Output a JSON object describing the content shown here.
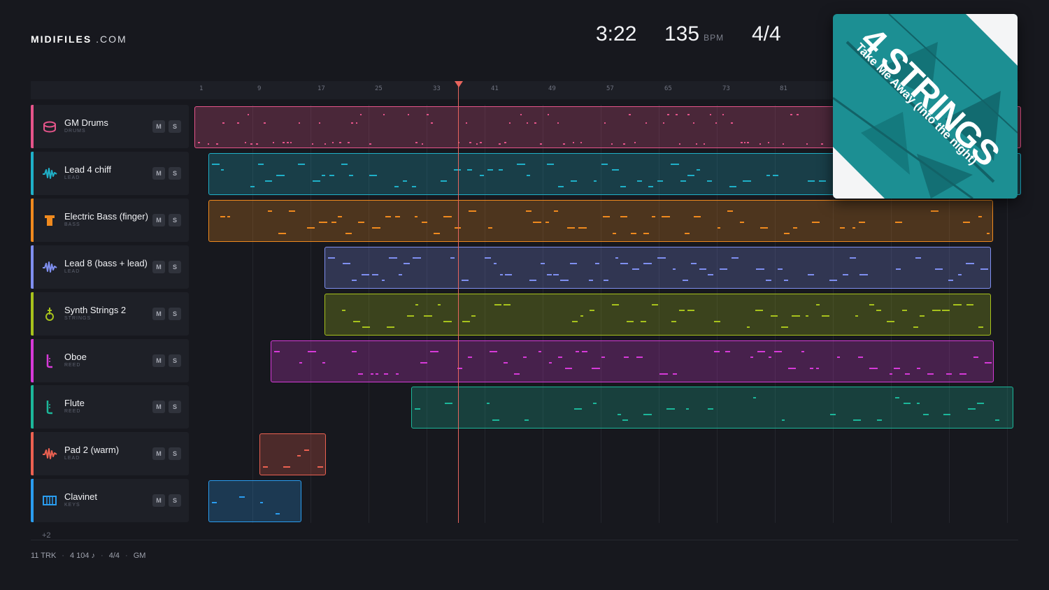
{
  "brand": {
    "bold": "MIDIFILES",
    "light": ".COM"
  },
  "transport": {
    "time": "3:22",
    "bpm": "135",
    "bpm_unit": "BPM",
    "signature": "4/4"
  },
  "ruler_ticks": [
    "1",
    "9",
    "17",
    "25",
    "33",
    "41",
    "49",
    "57",
    "65",
    "73",
    "81"
  ],
  "tracks": [
    {
      "name": "GM Drums",
      "category": "DRUMS",
      "color": "#e5548a",
      "icon": "drum-icon",
      "mute": "M",
      "solo": "S"
    },
    {
      "name": "Lead 4 chiff",
      "category": "LEAD",
      "color": "#1fb0c8",
      "icon": "waveform-icon",
      "mute": "M",
      "solo": "S"
    },
    {
      "name": "Electric Bass (finger)",
      "category": "BASS",
      "color": "#f08a1e",
      "icon": "bass-icon",
      "mute": "M",
      "solo": "S"
    },
    {
      "name": "Lead 8 (bass + lead)",
      "category": "LEAD",
      "color": "#7f8ff0",
      "icon": "waveform-icon",
      "mute": "M",
      "solo": "S"
    },
    {
      "name": "Synth Strings 2",
      "category": "STRINGS",
      "color": "#a7c21c",
      "icon": "strings-icon",
      "mute": "M",
      "solo": "S"
    },
    {
      "name": "Oboe",
      "category": "REED",
      "color": "#d63ad8",
      "icon": "reed-icon",
      "mute": "M",
      "solo": "S"
    },
    {
      "name": "Flute",
      "category": "REED",
      "color": "#1cb79a",
      "icon": "reed-icon",
      "mute": "M",
      "solo": "S"
    },
    {
      "name": "Pad 2 (warm)",
      "category": "LEAD",
      "color": "#ec6151",
      "icon": "waveform-icon",
      "mute": "M",
      "solo": "S"
    },
    {
      "name": "Clavinet",
      "category": "KEYS",
      "color": "#2a9df0",
      "icon": "keyboard-icon",
      "mute": "M",
      "solo": "S"
    }
  ],
  "more_tracks": "+2",
  "footer": {
    "tracks": "11 TRK",
    "notes": "4 104 ♪",
    "signature": "4/4",
    "standard": "GM"
  },
  "cover": {
    "artist": "4 STRINGS",
    "title": "Take Me Away (into the night)",
    "color": "#1c8f93"
  }
}
